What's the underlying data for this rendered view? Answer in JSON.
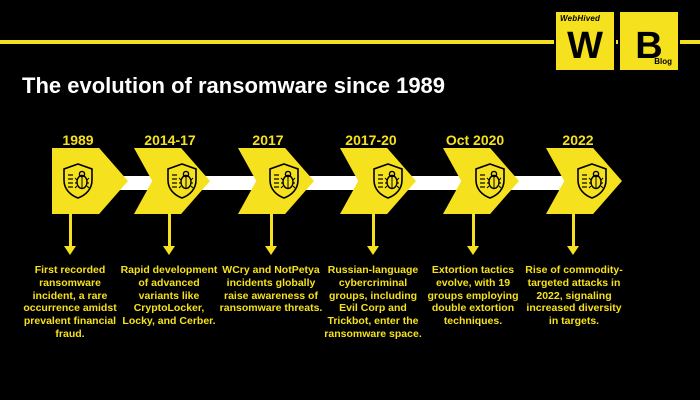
{
  "header": {
    "title": "The evolution of ransomware since 1989",
    "logo_brand_small": "WebHived",
    "logo_w": "W",
    "logo_b": "B",
    "logo_tag": "Blog"
  },
  "colors": {
    "accent": "#f5e11d",
    "background": "#000000",
    "spine": "#ffffff"
  },
  "timeline": [
    {
      "year": "1989",
      "icon": "bug-shield-icon",
      "text": "First recorded ransomware incident, a rare occurrence amidst prevalent financial fraud."
    },
    {
      "year": "2014-17",
      "icon": "bug-shield-icon",
      "text": "Rapid development of advanced variants like CryptoLocker, Locky, and Cerber."
    },
    {
      "year": "2017",
      "icon": "bug-shield-icon",
      "text": "WCry and NotPetya incidents globally raise awareness of ransomware threats."
    },
    {
      "year": "2017-20",
      "icon": "bug-shield-icon",
      "text": "Russian-language cybercriminal groups, including Evil Corp and Trickbot, enter the ransomware space."
    },
    {
      "year": "Oct 2020",
      "icon": "bug-shield-icon",
      "text": "Extortion tactics evolve, with 19 groups employing double extortion techniques."
    },
    {
      "year": "2022",
      "icon": "bug-shield-icon",
      "text": "Rise of commodity-targeted attacks in 2022, signaling increased diversity in targets."
    }
  ]
}
